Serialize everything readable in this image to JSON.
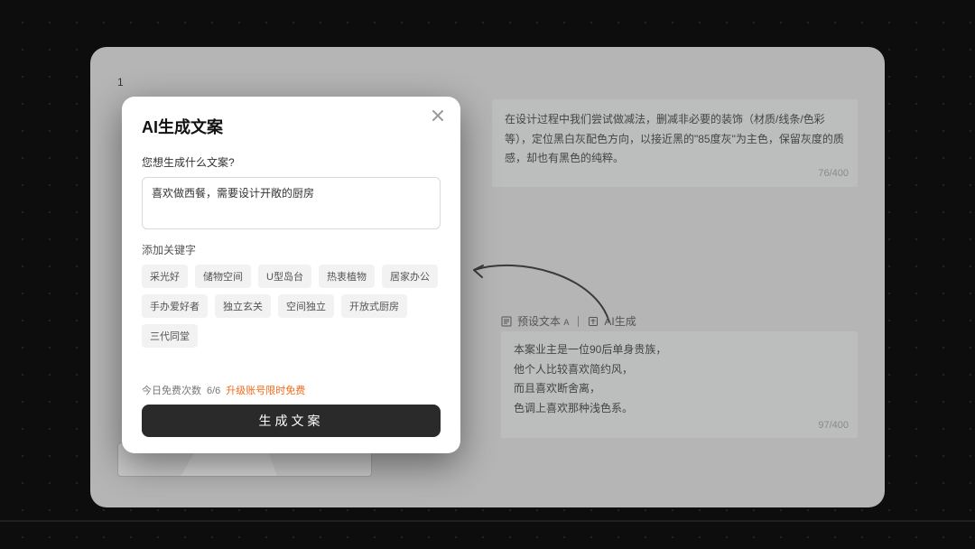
{
  "panel": {
    "index_label": "1"
  },
  "top_card": {
    "text": "在设计过程中我们尝试做减法，删减非必要的装饰（材质/线条/色彩等），定位黑白灰配色方向，以接近黑的\"85度灰\"为主色，保留灰度的质感，却也有黑色的纯粹。",
    "counter": "76/400"
  },
  "tabs": {
    "preset": "预设文本",
    "preset_suffix": "A",
    "ai": "AI生成"
  },
  "bottom_card": {
    "lines": [
      "本案业主是一位90后单身贵族，",
      "他个人比较喜欢简约风，",
      "而且喜欢断舍离，",
      "色调上喜欢那种浅色系。"
    ],
    "counter": "97/400"
  },
  "modal": {
    "title": "AI生成文案",
    "prompt_label": "您想生成什么文案?",
    "input_value": "喜欢做西餐，需要设计开敞的厨房",
    "keywords_label": "添加关键字",
    "chips": [
      "采光好",
      "储物空间",
      "U型岛台",
      "热衷植物",
      "居家办公",
      "手办爱好者",
      "独立玄关",
      "空间独立",
      "开放式厨房",
      "三代同堂"
    ],
    "quota_prefix": "今日免费次数",
    "quota_value": "6/6",
    "upgrade": "升级账号限时免费",
    "generate": "生成文案"
  }
}
